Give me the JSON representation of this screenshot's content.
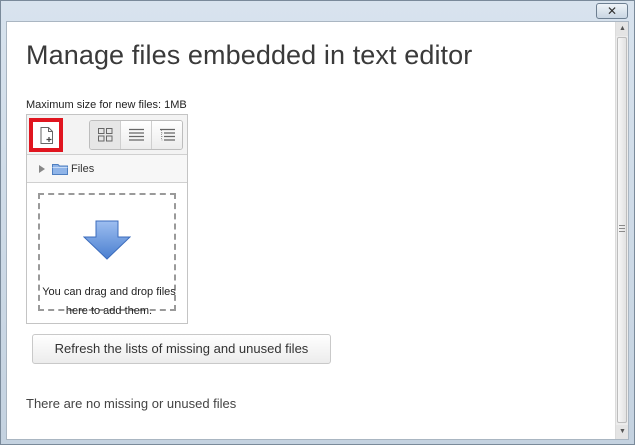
{
  "window": {
    "close_glyph": "✕"
  },
  "page": {
    "title": "Manage files embedded in text editor",
    "max_size_label": "Maximum size for new files: 1MB"
  },
  "filemanager": {
    "add_file_icon": "add-file-icon",
    "view_icons": [
      "grid-view-icon",
      "list-view-icon",
      "tree-view-icon"
    ],
    "path_label": "Files",
    "dropzone_text": "You can drag and drop files here to add them."
  },
  "actions": {
    "refresh_label": "Refresh the lists of missing and unused files"
  },
  "status": {
    "no_missing": "There are no missing or unused files"
  },
  "colors": {
    "highlight": "#e0151f",
    "arrow": "#5b8fd4"
  }
}
